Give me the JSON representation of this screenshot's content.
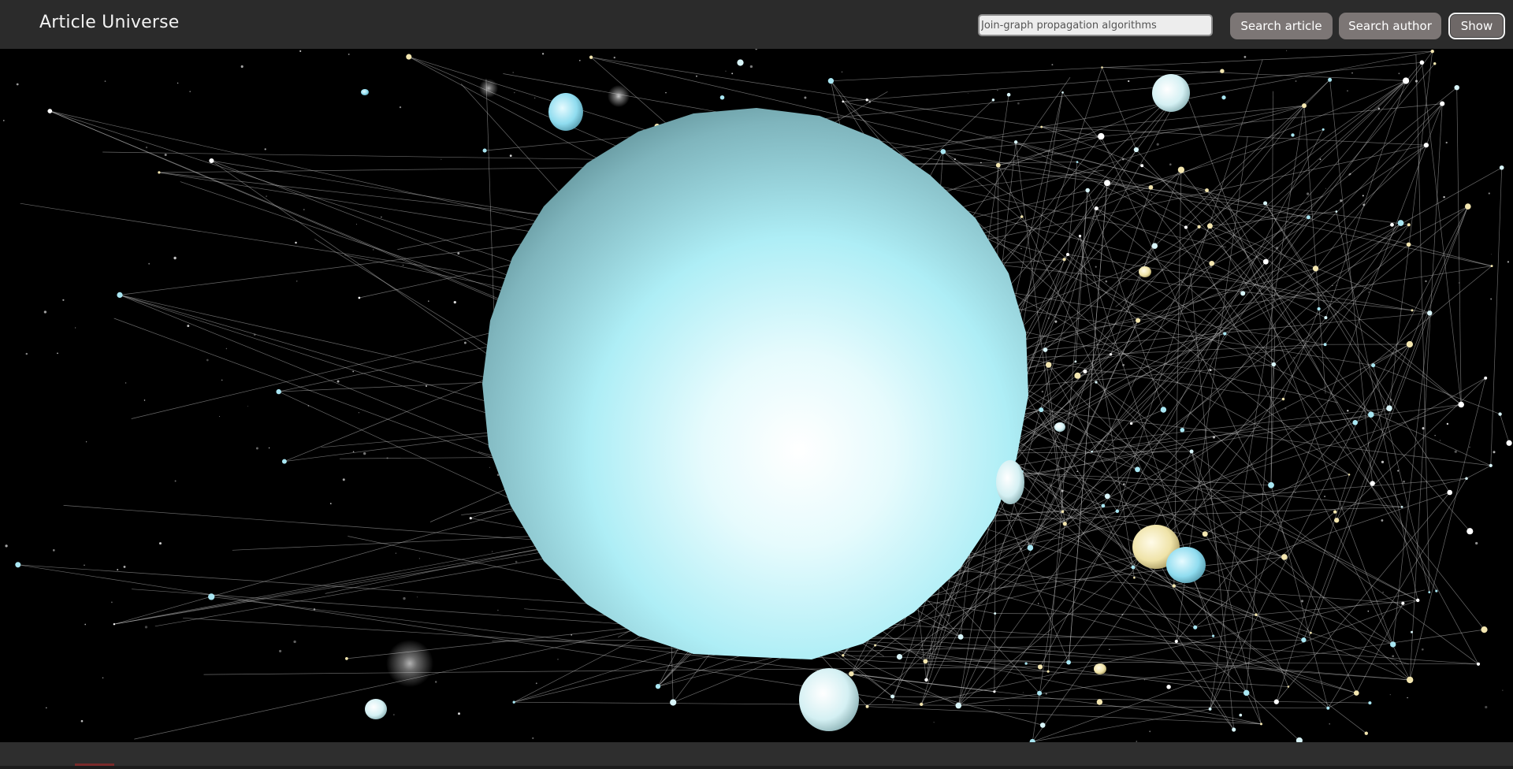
{
  "header": {
    "app_title": "Article Universe",
    "search_placeholder": "Join-graph propagation algorithms",
    "search_value": "",
    "search_article_label": "Search article",
    "search_author_label": "Search author",
    "show_label": "Show"
  },
  "scene": {
    "description_icon": "3d-graph-visualization",
    "background_color": "#000000",
    "link_color": "#bfbfbf",
    "focus_node_color": "#a9eef6",
    "node_color_primary": "#cfeff4",
    "node_color_accent": "#f2e7b6"
  },
  "colors": {
    "topbar": "#2b2b2b",
    "button": "#7c7675",
    "button_text": "#ffffff",
    "title_text": "#f2f2f2"
  }
}
